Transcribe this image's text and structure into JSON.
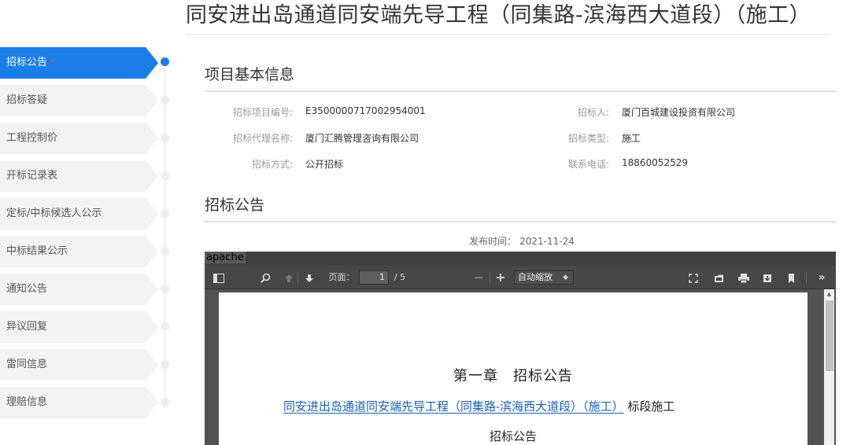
{
  "page_title": "同安进出岛通道同安端先导工程（同集路-滨海西大道段）（施工）",
  "sidebar": {
    "items": [
      {
        "label": "招标公告",
        "required_mark": "*"
      },
      {
        "label": "招标答疑"
      },
      {
        "label": "工程控制价"
      },
      {
        "label": "开标记录表"
      },
      {
        "label": "定标/中标候选人公示"
      },
      {
        "label": "中标结果公示"
      },
      {
        "label": "通知公告"
      },
      {
        "label": "异议回复"
      },
      {
        "label": "雷同信息"
      },
      {
        "label": "理赔信息"
      }
    ]
  },
  "basic_info": {
    "heading": "项目基本信息",
    "fields": {
      "project_no_label": "招标项目编号:",
      "project_no": "E3500000717002954001",
      "tenderer_label": "招标人:",
      "tenderer": "厦门百城建设投资有限公司",
      "agent_label": "招标代理名称:",
      "agent": "厦门汇腾管理咨询有限公司",
      "type_label": "招标类型:",
      "type": "施工",
      "method_label": "招标方式:",
      "method": "公开招标",
      "phone_label": "联系电话:",
      "phone": "18860052529"
    }
  },
  "notice": {
    "heading": "招标公告",
    "publish_label": "发布时间：",
    "publish_date": "2021-11-24"
  },
  "viewer": {
    "label": "apache",
    "page_label": "页面：",
    "page_current": "1",
    "page_total": "/ 5",
    "zoom_minus": "—",
    "zoom_plus": "+",
    "zoom_value": "自动缩放",
    "icons": [
      "sidebar-toggle-icon",
      "search-icon",
      "previous-page-icon",
      "next-page-icon",
      "fullscreen-icon",
      "open-file-icon",
      "print-icon",
      "download-icon",
      "bookmark-icon",
      "more-tools-icon"
    ]
  },
  "document": {
    "chapter": "第一章　招标公告",
    "line_underlined": "同安进出岛通道同安端先导工程（同集路-滨海西大道段）（施工）",
    "line_suffix": "标段施工",
    "sub": "招标公告"
  },
  "colors": {
    "accent": "#1a7ee8",
    "required": "#ff4d4d",
    "link": "#1a5fb4"
  }
}
